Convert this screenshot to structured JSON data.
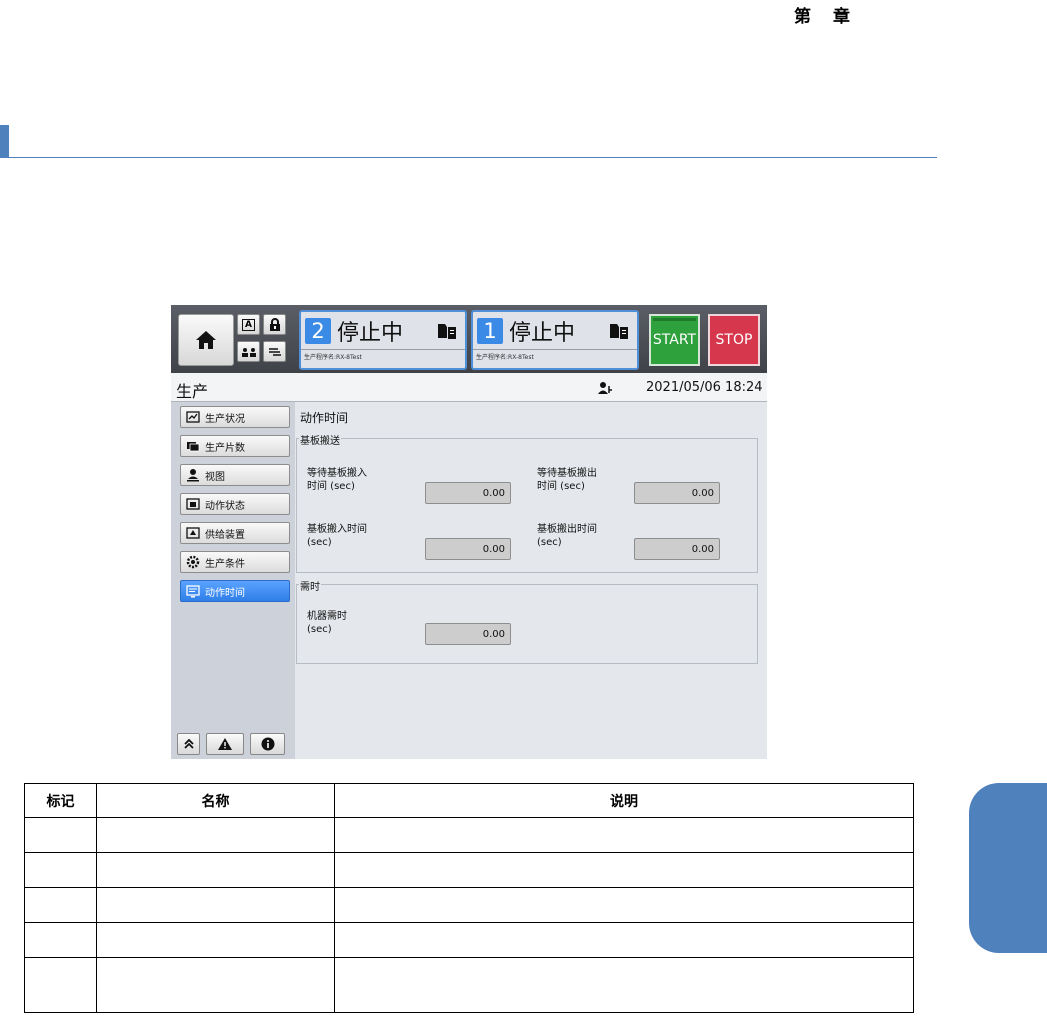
{
  "doc": {
    "chapter_header": [
      "第",
      "章"
    ]
  },
  "screen": {
    "lanes": [
      {
        "number": "2",
        "status": "停止中",
        "program": "生产程序名:RX-8Test"
      },
      {
        "number": "1",
        "status": "停止中",
        "program": "生产程序名:RX-8Test"
      }
    ],
    "start_label": "START",
    "stop_label": "STOP",
    "mini_buttons": [
      "A",
      ""
    ],
    "page_title": "生产",
    "datetime": "2021/05/06 18:24",
    "nav": [
      {
        "label": "生产状况",
        "icon": "chart-icon",
        "active": false
      },
      {
        "label": "生产片数",
        "icon": "boards-icon",
        "active": false
      },
      {
        "label": "视图",
        "icon": "person-view-icon",
        "active": false
      },
      {
        "label": "动作状态",
        "icon": "status-icon",
        "active": false
      },
      {
        "label": "供给装置",
        "icon": "feeder-icon",
        "active": false
      },
      {
        "label": "生产条件",
        "icon": "gear-icon",
        "active": false
      },
      {
        "label": "动作时间",
        "icon": "time-icon",
        "active": true
      }
    ],
    "content_title": "动作时间",
    "group_transfer": {
      "label": "基板搬送",
      "fields": [
        {
          "label": "等待基板搬入\n时间 (sec)",
          "value": "0.00"
        },
        {
          "label": "等待基板搬出\n时间 (sec)",
          "value": "0.00"
        },
        {
          "label": "基板搬入时间\n(sec)",
          "value": "0.00"
        },
        {
          "label": "基板搬出时间\n(sec)",
          "value": "0.00"
        }
      ]
    },
    "group_required": {
      "label": "需时",
      "fields": [
        {
          "label": "机器需时\n(sec)",
          "value": "0.00"
        }
      ]
    }
  },
  "table": {
    "headers": [
      "标记",
      "名称",
      "说明"
    ],
    "rows": [
      [
        "",
        "",
        ""
      ],
      [
        "",
        "",
        ""
      ],
      [
        "",
        "",
        ""
      ],
      [
        "",
        "",
        ""
      ],
      [
        "",
        "",
        ""
      ]
    ]
  },
  "colors": {
    "accent": "#4f81bd",
    "start": "#2ea03c",
    "stop": "#d6374d",
    "active_nav": "#3b8ae6"
  }
}
